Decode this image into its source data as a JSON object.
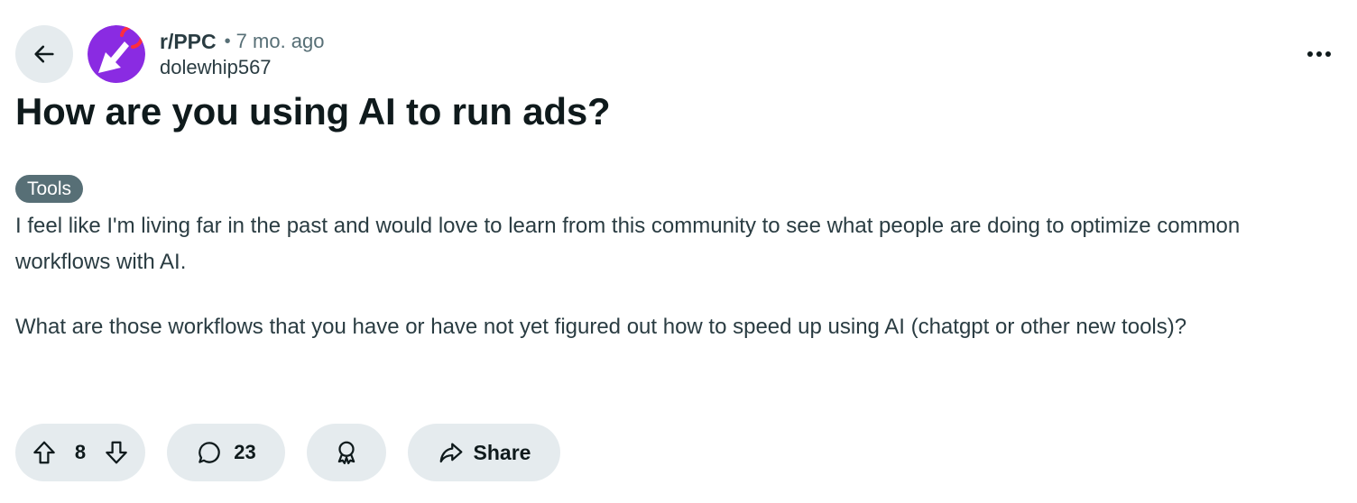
{
  "header": {
    "subreddit": "r/PPC",
    "separator": "•",
    "age": "7 mo. ago",
    "author": "dolewhip567"
  },
  "post": {
    "title": "How are you using AI to run ads?",
    "flair": "Tools",
    "paragraphs": [
      "I feel like I'm living far in the past and would love to learn from this community to see what people are doing to optimize common workflows with AI.",
      "What are those workflows that you have or have not yet figured out how to speed up using AI (chatgpt or other new tools)?"
    ]
  },
  "actions": {
    "votes": "8",
    "comments": "23",
    "share_label": "Share"
  },
  "icons": {
    "back": "arrow-left-icon",
    "more": "ellipsis-icon",
    "upvote": "arrow-up-icon",
    "downvote": "arrow-down-icon",
    "comment": "speech-bubble-icon",
    "award": "award-icon",
    "share": "share-arrow-icon"
  },
  "colors": {
    "avatar_bg": "#8a2be2",
    "avatar_accent": "#ff2d3d",
    "pill_bg": "#e5ebee",
    "flair_bg": "#576f76",
    "text_primary": "#0f1a1c",
    "text_secondary": "#576f76"
  }
}
